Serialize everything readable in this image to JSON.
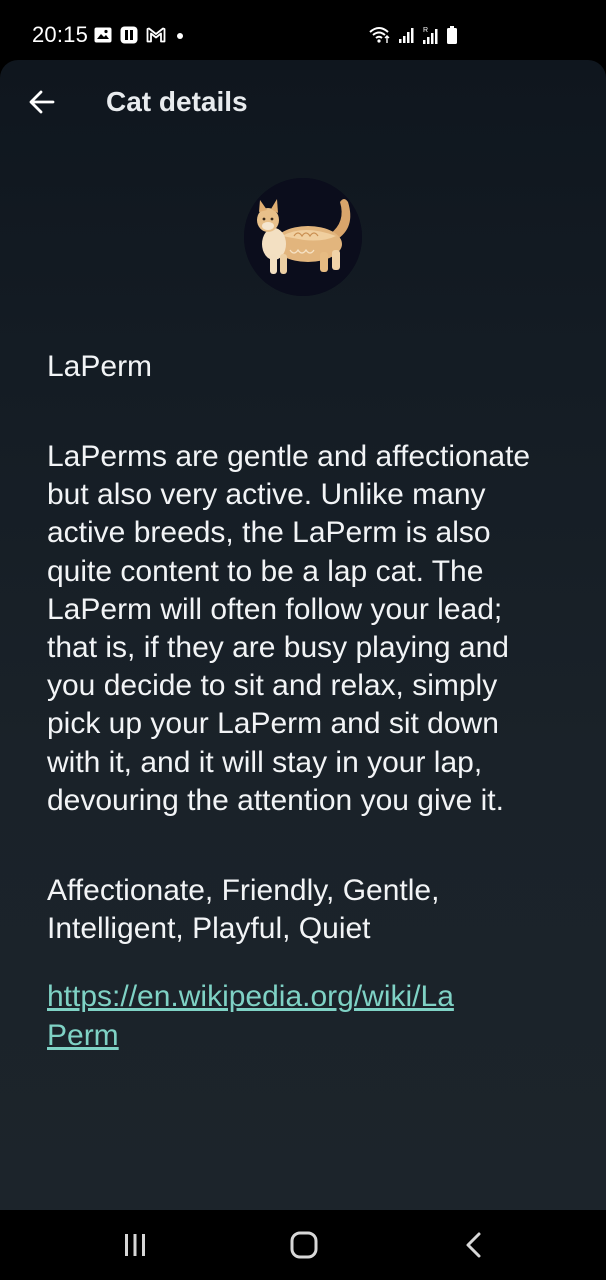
{
  "status_bar": {
    "time": "20:15",
    "left_icons": [
      "gallery-icon",
      "messenger-icon",
      "gmail-icon",
      "dot-icon"
    ],
    "right_icons": [
      "wifi-icon",
      "signal-icon",
      "roaming-signal-icon",
      "battery-icon"
    ]
  },
  "app_bar": {
    "title": "Cat details",
    "back_icon": "arrow-left-icon"
  },
  "cat": {
    "name": "LaPerm",
    "description": "LaPerms are gentle and affectionate but also very active. Unlike many active breeds, the LaPerm is also quite content to be a lap cat. The LaPerm will often follow your lead; that is, if they are busy playing and you decide to sit and relax, simply pick up your LaPerm and sit down with it, and it will stay in your lap, devouring the attention you give it.",
    "temperament": "Affectionate, Friendly, Gentle, Intelligent, Playful, Quiet",
    "wikipedia_url": "https://en.wikipedia.org/wiki/LaPerm"
  },
  "nav_bar": {
    "recents_icon": "recents-icon",
    "home_icon": "home-icon",
    "back_icon": "back-chevron-icon"
  },
  "colors": {
    "background": "#1a2229",
    "text": "#f2f4f6",
    "link": "#7fd2c5"
  }
}
